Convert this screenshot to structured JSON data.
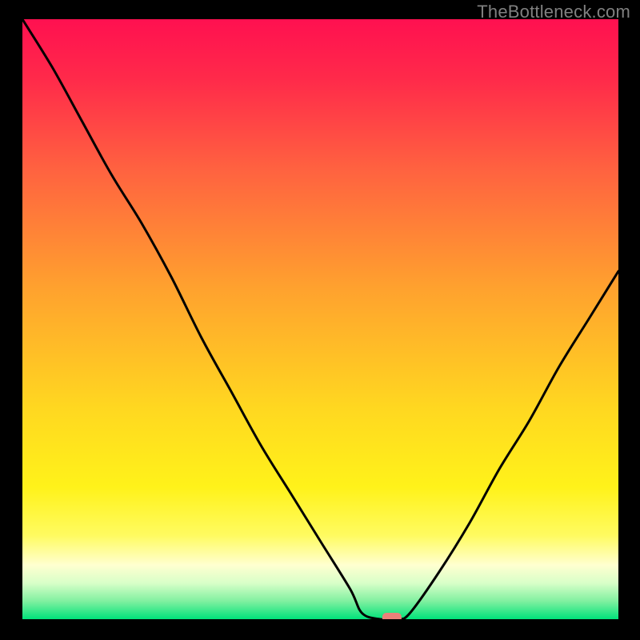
{
  "watermark": "TheBottleneck.com",
  "colors": {
    "frame_bg": "#000000",
    "watermark": "#808080",
    "curve": "#000000",
    "marker": "#eb8079",
    "green": "#00e27a"
  },
  "plot": {
    "inner_width": 745,
    "inner_height": 750
  },
  "chart_data": {
    "type": "line",
    "title": "",
    "xlabel": "",
    "ylabel": "",
    "xlim": [
      0,
      100
    ],
    "ylim": [
      0,
      100
    ],
    "x": [
      0,
      5,
      10,
      15,
      20,
      25,
      30,
      35,
      40,
      45,
      50,
      55,
      57,
      60,
      63,
      65,
      70,
      75,
      80,
      85,
      90,
      95,
      100
    ],
    "y": [
      100,
      92,
      83,
      74,
      66,
      57,
      47,
      38,
      29,
      21,
      13,
      5,
      1,
      0,
      0,
      1,
      8,
      16,
      25,
      33,
      42,
      50,
      58
    ],
    "marker": {
      "x": 62,
      "y": 0
    },
    "gradient_stops": [
      {
        "offset": 0.0,
        "color": "#ff1050"
      },
      {
        "offset": 0.1,
        "color": "#ff2a4a"
      },
      {
        "offset": 0.25,
        "color": "#ff6240"
      },
      {
        "offset": 0.45,
        "color": "#ffa22e"
      },
      {
        "offset": 0.65,
        "color": "#ffd820"
      },
      {
        "offset": 0.78,
        "color": "#fff21a"
      },
      {
        "offset": 0.86,
        "color": "#fffb60"
      },
      {
        "offset": 0.91,
        "color": "#ffffd0"
      },
      {
        "offset": 0.94,
        "color": "#d8ffc8"
      },
      {
        "offset": 0.97,
        "color": "#80f0a0"
      },
      {
        "offset": 1.0,
        "color": "#00e27a"
      }
    ]
  }
}
